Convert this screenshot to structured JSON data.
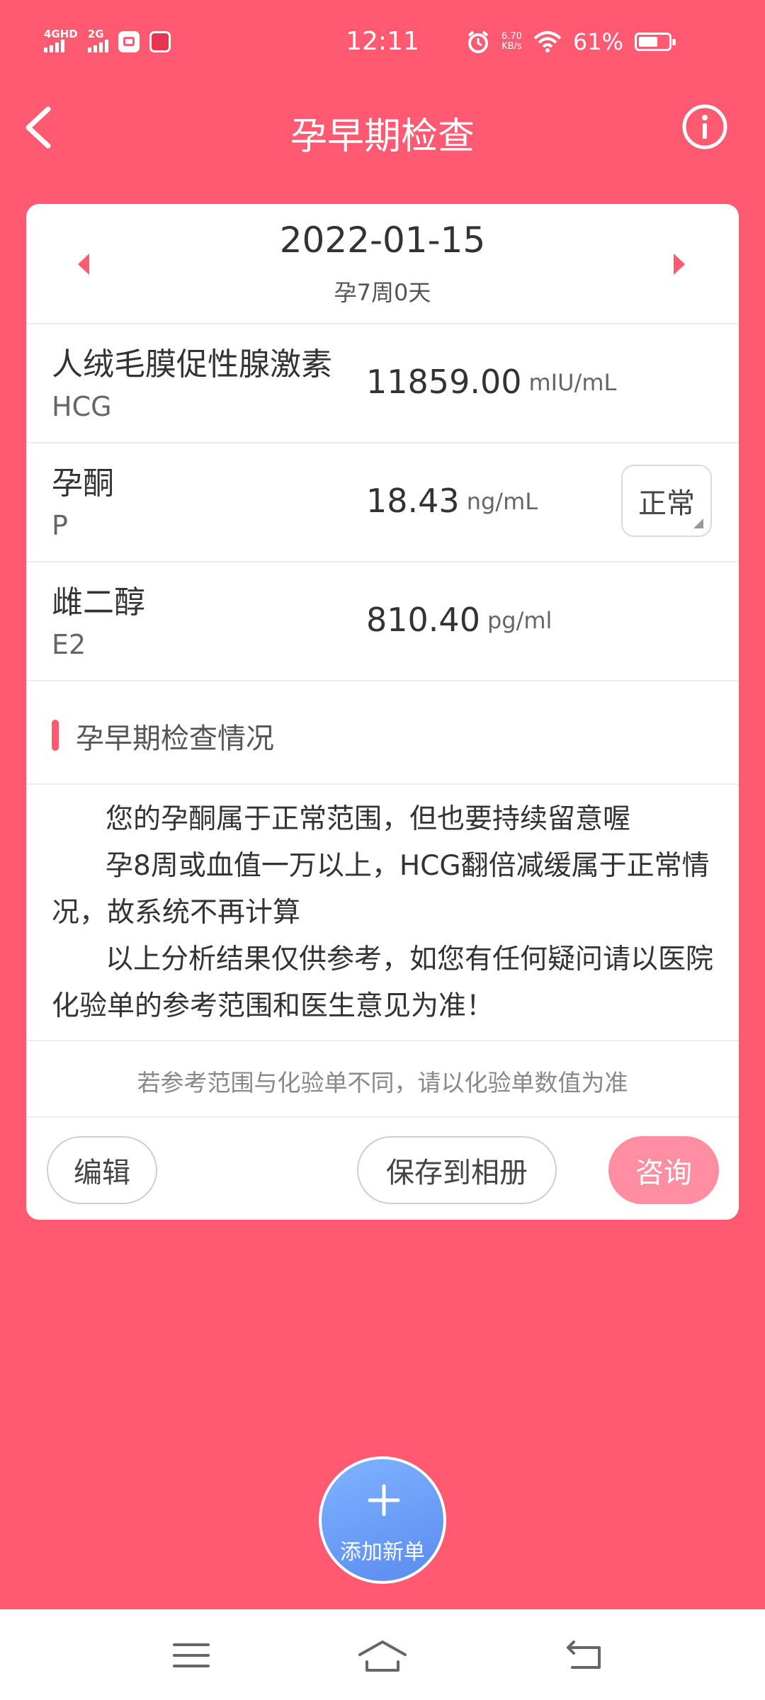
{
  "status_bar": {
    "network1": "4GHD",
    "network2": "2G",
    "time": "12:11",
    "speed_value": "6.70",
    "speed_unit": "KB/s",
    "battery": "61%"
  },
  "header": {
    "title": "孕早期检查",
    "back_icon": "chevron-left-icon",
    "info_icon": "info-icon"
  },
  "record": {
    "date": "2022-01-15",
    "week": "孕7周0天"
  },
  "items": [
    {
      "name": "人绒毛膜促性腺激素",
      "abbr": "HCG",
      "value": "11859.00",
      "unit": "mIU/mL",
      "status": ""
    },
    {
      "name": "孕酮",
      "abbr": "P",
      "value": "18.43",
      "unit": "ng/mL",
      "status": "正常"
    },
    {
      "name": "雌二醇",
      "abbr": "E2",
      "value": "810.40",
      "unit": "pg/ml",
      "status": ""
    }
  ],
  "section": {
    "title": "孕早期检查情况",
    "paragraphs": [
      "您的孕酮属于正常范围，但也要持续留意喔",
      "孕8周或血值一万以上，HCG翻倍减缓属于正常情况，故系统不再计算",
      "以上分析结果仅供参考，如您有任何疑问请以医院化验单的参考范围和医生意见为准！"
    ]
  },
  "note": "若参考范围与化验单不同，请以化验单数值为准",
  "actions": {
    "edit": "编辑",
    "save": "保存到相册",
    "consult": "咨询"
  },
  "fab": {
    "label": "添加新单",
    "icon": "plus-icon"
  },
  "colors": {
    "brand": "#FF5A72",
    "consult_button": "#FF8EA2",
    "fab": "#6A9BF7"
  }
}
